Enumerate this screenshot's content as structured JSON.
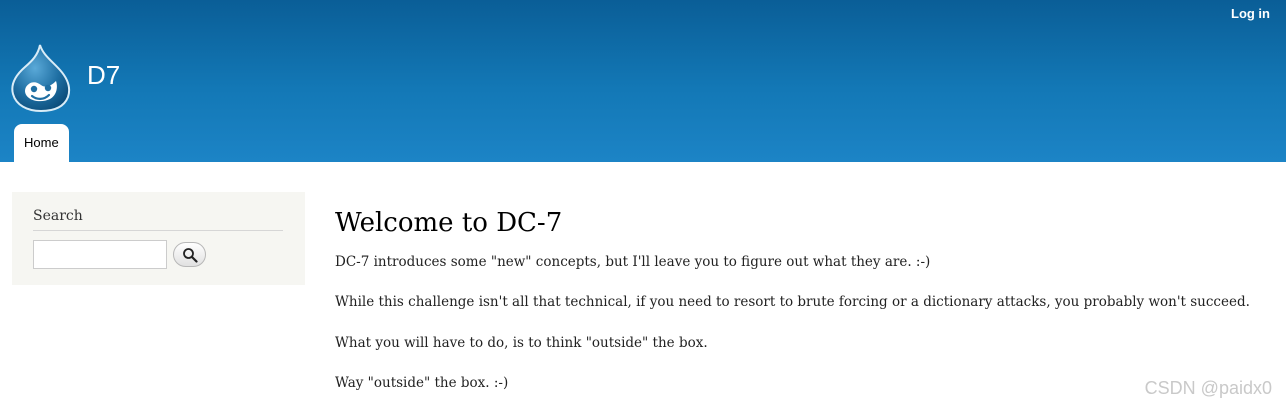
{
  "header": {
    "login_label": "Log in",
    "site_name": "D7",
    "logo_icon": "drupal-drop-icon",
    "colors": {
      "top": "#0a5e97",
      "bottom": "#1c84c6"
    }
  },
  "main_menu": {
    "items": [
      {
        "label": "Home"
      }
    ]
  },
  "sidebar": {
    "search_block": {
      "title": "Search",
      "input_value": "",
      "button_icon": "magnifier-icon"
    }
  },
  "content": {
    "title": "Welcome to DC-7",
    "paragraphs": [
      "DC-7 introduces some \"new\" concepts, but I'll leave you to figure out what they are.  :-)",
      "While this challenge isn't all that technical, if you need to resort to brute forcing or a dictionary attacks, you probably won't succeed.",
      "What you will have to do, is to think \"outside\" the box.",
      "Way \"outside\" the box.  :-)"
    ]
  },
  "watermark": "CSDN @paidx0"
}
